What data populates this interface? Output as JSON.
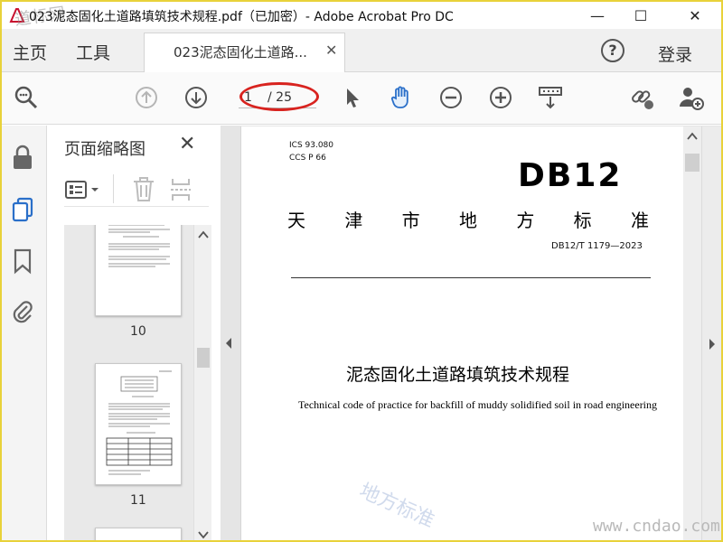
{
  "window": {
    "title": "023泥态固化土道路填筑技术规程.pdf（已加密）- Adobe Acrobat Pro DC",
    "watermark_corner": "道标网",
    "minimize": "—",
    "maximize": "☐",
    "close": "✕"
  },
  "menubar": {
    "home": "主页",
    "tools": "工具",
    "tab_label": "023泥态固化土道路...",
    "tab_close": "✕",
    "help": "?",
    "login": "登录"
  },
  "toolbar": {
    "page_current": "1",
    "page_total": "/ 25"
  },
  "panel": {
    "title": "页面缩略图",
    "close": "✕",
    "thumbnails": [
      {
        "label": "10"
      },
      {
        "label": "11"
      }
    ]
  },
  "document": {
    "ics": "ICS  93.080",
    "ccs": "CCS  P 66",
    "logo": "DB12",
    "region_chars": [
      "天",
      "津",
      "市",
      "地",
      "方",
      "标",
      "准"
    ],
    "doc_number": "DB12/T 1179—2023",
    "title_cn": "泥态固化土道路填筑技术规程",
    "title_en": "Technical code of practice for backfill of muddy solidified soil in road engineering",
    "watermark_diag": "地方标准",
    "watermark_site": "www.cndao.com"
  },
  "colors": {
    "frame_border": "#e8d23a",
    "annotation_ellipse": "#d8231f",
    "hand_tool_accent": "#2a6fc9",
    "nav_active_accent": "#2a6fc9"
  },
  "icons": [
    "acrobat-icon",
    "search-zoom-icon",
    "page-up-icon",
    "page-down-icon",
    "select-arrow-icon",
    "hand-icon",
    "zoom-out-icon",
    "zoom-in-icon",
    "scroll-mode-icon",
    "share-link-icon",
    "add-user-icon",
    "lock-icon",
    "pages-icon",
    "bookmark-icon",
    "attachment-icon",
    "options-icon",
    "delete-icon",
    "extract-icon"
  ]
}
